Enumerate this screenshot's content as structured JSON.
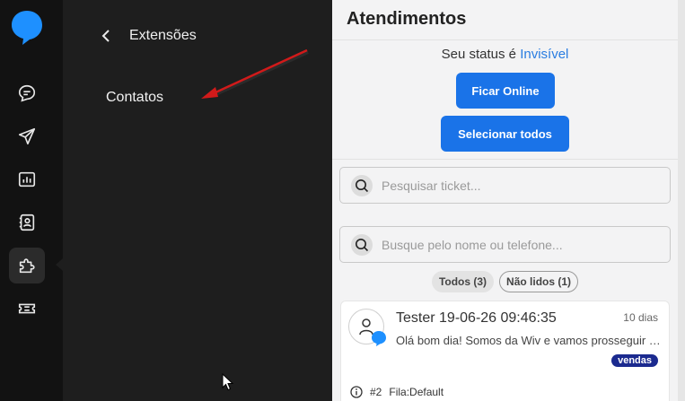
{
  "rail": {
    "items": [
      "chat-icon",
      "send-icon",
      "dashboard-icon",
      "contacts-book-icon",
      "puzzle-icon",
      "ticket-icon"
    ],
    "active": "puzzle-icon"
  },
  "extensions": {
    "title": "Extensões",
    "items": [
      {
        "label": "Contatos"
      }
    ]
  },
  "main": {
    "title": "Atendimentos",
    "status_prefix": "Seu status é",
    "status_value": "Invisível",
    "go_online_label": "Ficar Online",
    "select_all_label": "Selecionar todos",
    "ticket_search_placeholder": "Pesquisar ticket...",
    "contact_search_placeholder": "Busque pelo nome ou telefone...",
    "filters": [
      {
        "label": "Todos (3)"
      },
      {
        "label": "Não lidos (1)"
      }
    ],
    "tickets": [
      {
        "name": "Tester 19-06-26 09:46:35",
        "time": "10 dias",
        "message": "Olá bom dia! Somos da Wiv e vamos prosseguir com o seu atendimento",
        "tag": "vendas",
        "number": "#2",
        "queue": "Fila:Default"
      }
    ]
  },
  "colors": {
    "accent": "#1a73e8",
    "tag": "#1b2a8f",
    "annotation_arrow": "#d11a1a"
  }
}
